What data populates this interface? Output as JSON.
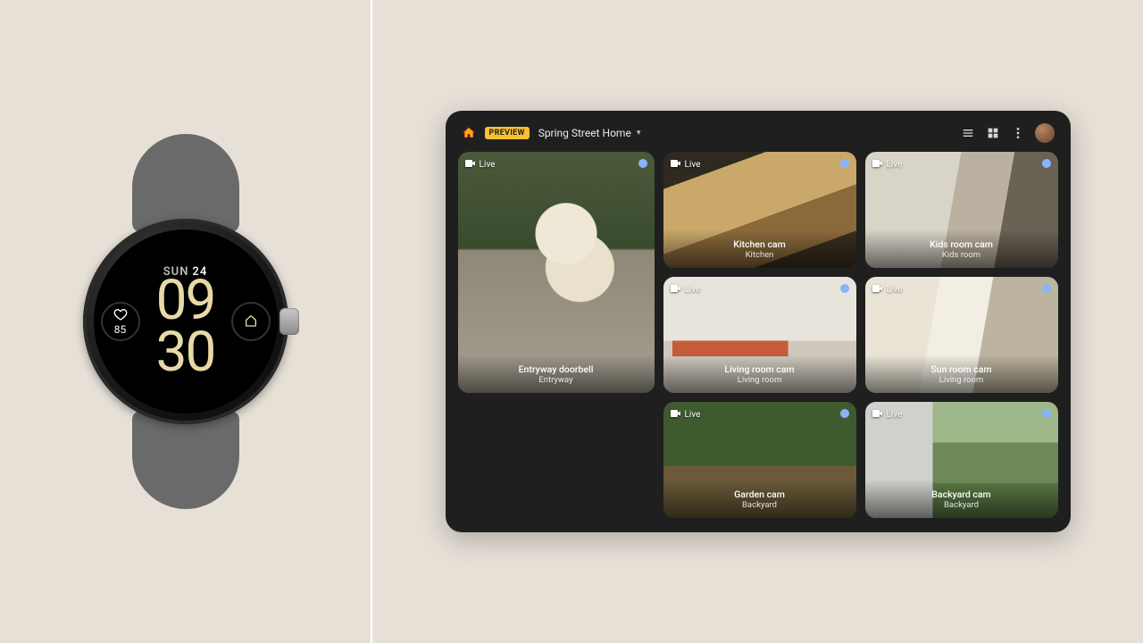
{
  "watch": {
    "day": "SUN",
    "date": "24",
    "hour": "09",
    "minute": "30",
    "heart_rate": "85"
  },
  "dashboard": {
    "badge": "PREVIEW",
    "home_name": "Spring Street Home",
    "live_label": "Live",
    "cameras": [
      {
        "name": "Entryway doorbell",
        "room": "Entryway"
      },
      {
        "name": "Kitchen cam",
        "room": "Kitchen"
      },
      {
        "name": "Kids room cam",
        "room": "Kids room"
      },
      {
        "name": "Living room cam",
        "room": "Living room"
      },
      {
        "name": "Sun room cam",
        "room": "Living room"
      },
      {
        "name": "Garden cam",
        "room": "Backyard"
      },
      {
        "name": "Backyard cam",
        "room": "Backyard"
      }
    ]
  }
}
